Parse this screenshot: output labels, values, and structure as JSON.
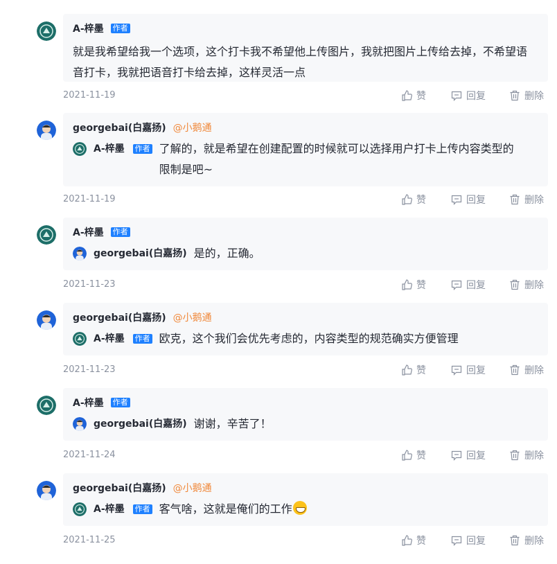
{
  "labels": {
    "author_badge": "作者",
    "like": "赞",
    "reply": "回复",
    "delete": "删除"
  },
  "users": {
    "a": "A-梓墨",
    "g": "georgebai(白嘉扬)"
  },
  "mention": "@小鹅通",
  "comments": [
    {
      "body": "就是我希望给我一个选项，这个打卡我不希望他上传图片，我就把图片上传给去掉，不希望语音打卡，我就把语音打卡给去掉，这样灵活一点",
      "date": "2021-11-19"
    },
    {
      "body": "了解的，就是希望在创建配置的时候就可以选择用户打卡上传内容类型的限制是吧~",
      "date": "2021-11-19"
    },
    {
      "body": "是的，正确。",
      "date": "2021-11-23"
    },
    {
      "body": "欧克，这个我们会优先考虑的，内容类型的规范确实方便管理",
      "date": "2021-11-23"
    },
    {
      "body": "谢谢，辛苦了！",
      "date": "2021-11-24"
    },
    {
      "body": "客气啥，这就是俺们的工作",
      "date": "2021-11-25"
    }
  ],
  "icons": {
    "like": "thumbs-up-icon",
    "reply": "comment-icon",
    "delete": "trash-icon",
    "emoji": "grinning-emoji-icon"
  },
  "colors": {
    "accent": "#1e80ff",
    "mention": "#f0883a",
    "bubble": "#f7f8fa",
    "muted": "#8a919f"
  }
}
